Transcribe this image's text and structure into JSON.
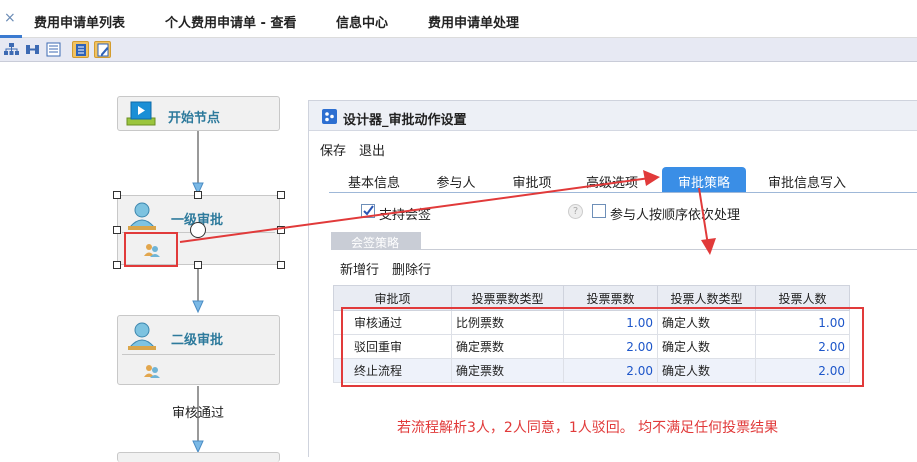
{
  "top_tabs": [
    {
      "label": "费用申请单列表"
    },
    {
      "label": "个人费用申请单 - 查看"
    },
    {
      "label": "信息中心"
    },
    {
      "label": "费用申请单处理"
    }
  ],
  "close_glyph": "×",
  "toolbar": {
    "icons": [
      "org-chart-icon",
      "network-icon",
      "list-icon",
      "grid-icon",
      "pencil-icon"
    ],
    "selected": [
      "grid-icon",
      "pencil-icon"
    ]
  },
  "flow": {
    "start_label": "开始节点",
    "node1_label": "一级审批",
    "node2_label": "二级审批",
    "edge_label": "审核通过"
  },
  "panel": {
    "title": "设计器_审批动作设置",
    "menu": [
      "保存",
      "退出"
    ],
    "tabs": [
      "基本信息",
      "参与人",
      "审批项",
      "高级选项",
      "审批策略",
      "审批信息写入"
    ],
    "active_tab": "审批策略",
    "checkbox_countersign": {
      "label": "支持会签",
      "checked": true
    },
    "checkbox_sequence": {
      "label": "参与人按顺序依次处理",
      "checked": false
    },
    "help_glyph": "?",
    "section_tab": "会签策略",
    "actions": [
      "新增行",
      "删除行"
    ],
    "table": {
      "columns": [
        "审批项",
        "投票票数类型",
        "投票票数",
        "投票人数类型",
        "投票人数"
      ],
      "rows": [
        [
          "审核通过",
          "比例票数",
          "1.00",
          "确定人数",
          "1.00"
        ],
        [
          "驳回重审",
          "确定票数",
          "2.00",
          "确定人数",
          "2.00"
        ],
        [
          "终止流程",
          "确定票数",
          "2.00",
          "确定人数",
          "2.00"
        ]
      ]
    },
    "note": "若流程解析3人，2人同意，1人驳回。 均不满足任何投票结果"
  },
  "colors": {
    "accent": "#3a8ee6",
    "annotation_red": "#e13a3a",
    "node_title": "#2d7a9c",
    "number_blue": "#1d56c9"
  }
}
